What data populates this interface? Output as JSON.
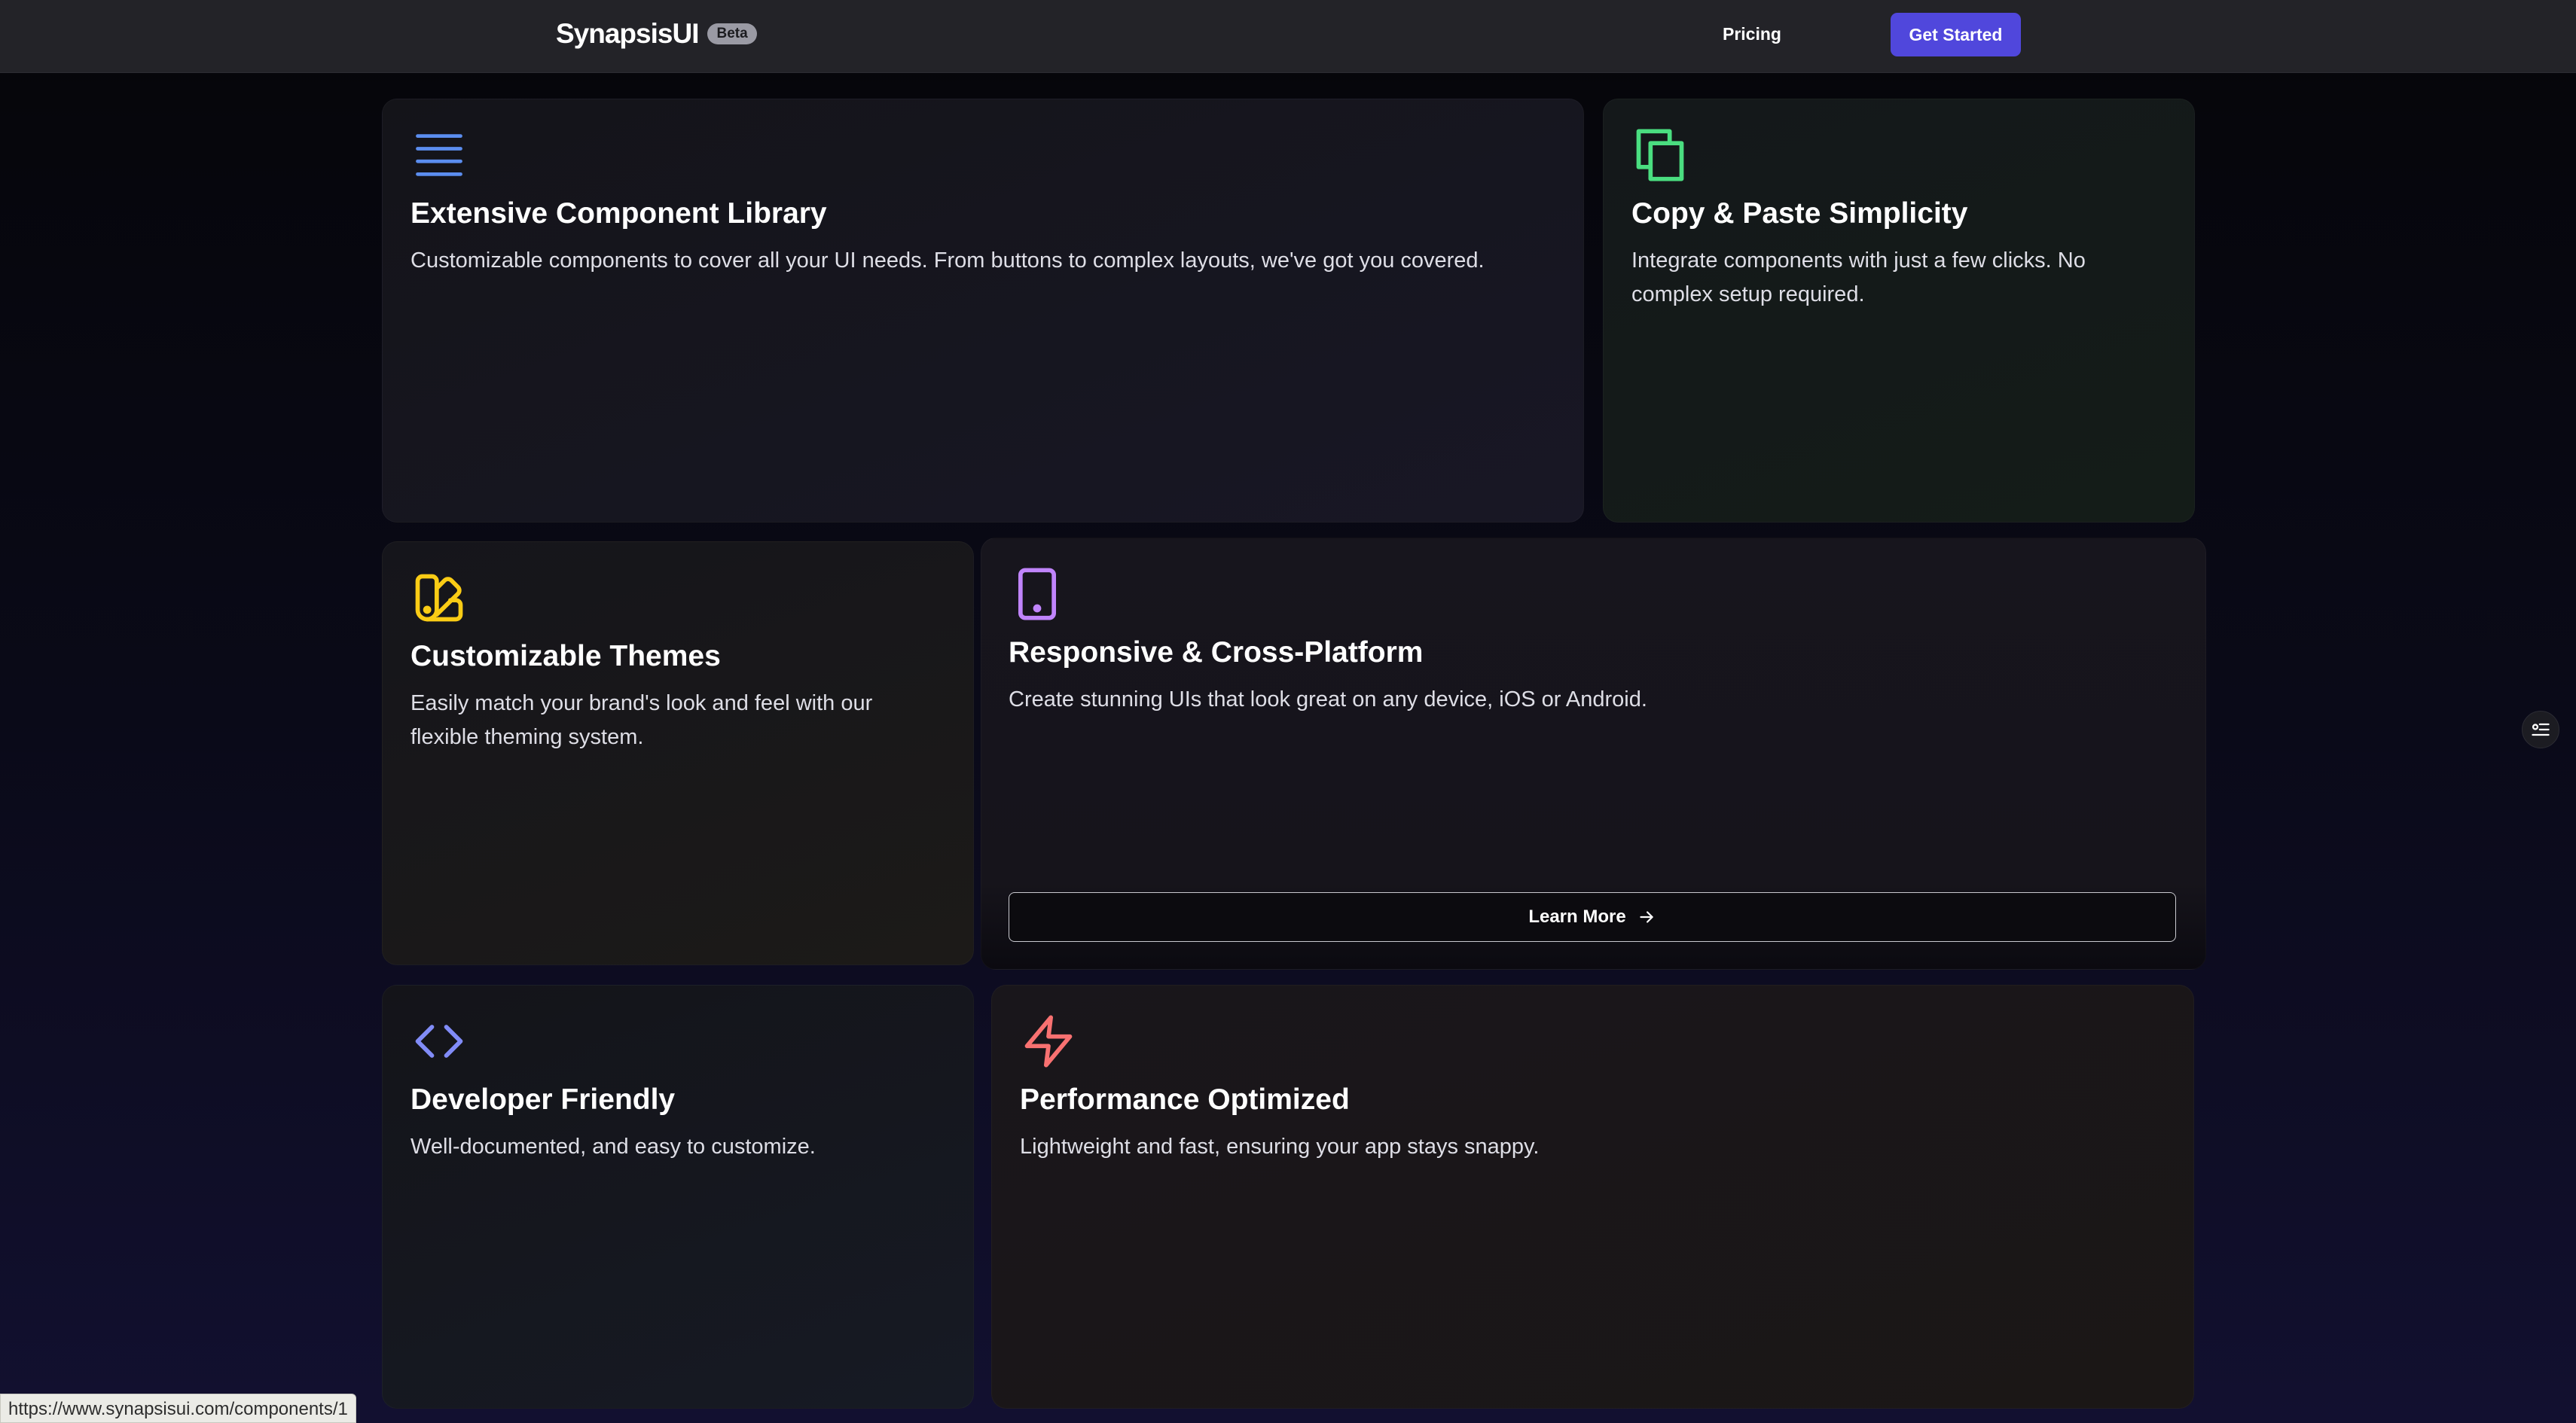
{
  "header": {
    "brand": "SynapsisUI",
    "badge": "Beta",
    "nav_pricing": "Pricing",
    "cta": "Get Started"
  },
  "features": [
    {
      "title": "Extensive Component Library",
      "description": "Customizable components to cover all your UI needs. From buttons to complex layouts, we've got you covered.",
      "icon": "menu-lines-icon",
      "icon_color": "#5b8def"
    },
    {
      "title": "Copy & Paste Simplicity",
      "description": "Integrate components with just a few clicks. No complex setup required.",
      "icon": "copy-icon",
      "icon_color": "#4ade80"
    },
    {
      "title": "Customizable Themes",
      "description": "Easily match your brand's look and feel with our flexible theming system.",
      "icon": "swatch-book-icon",
      "icon_color": "#facc15"
    },
    {
      "title": "Responsive & Cross-Platform",
      "description": "Create stunning UIs that look great on any device, iOS or Android.",
      "icon": "smartphone-icon",
      "icon_color": "#c084fc",
      "button": "Learn More"
    },
    {
      "title": "Developer Friendly",
      "description": "Well-documented, and easy to customize.",
      "icon": "code-icon",
      "icon_color": "#818cf8"
    },
    {
      "title": "Performance Optimized",
      "description": "Lightweight and fast, ensuring your app stays snappy.",
      "icon": "zap-icon",
      "icon_color": "#f87171"
    }
  ],
  "status_bar": {
    "hover_url": "https://www.synapsisui.com/components/1"
  },
  "colors": {
    "accent": "#5047dc",
    "background": "#08080f"
  }
}
